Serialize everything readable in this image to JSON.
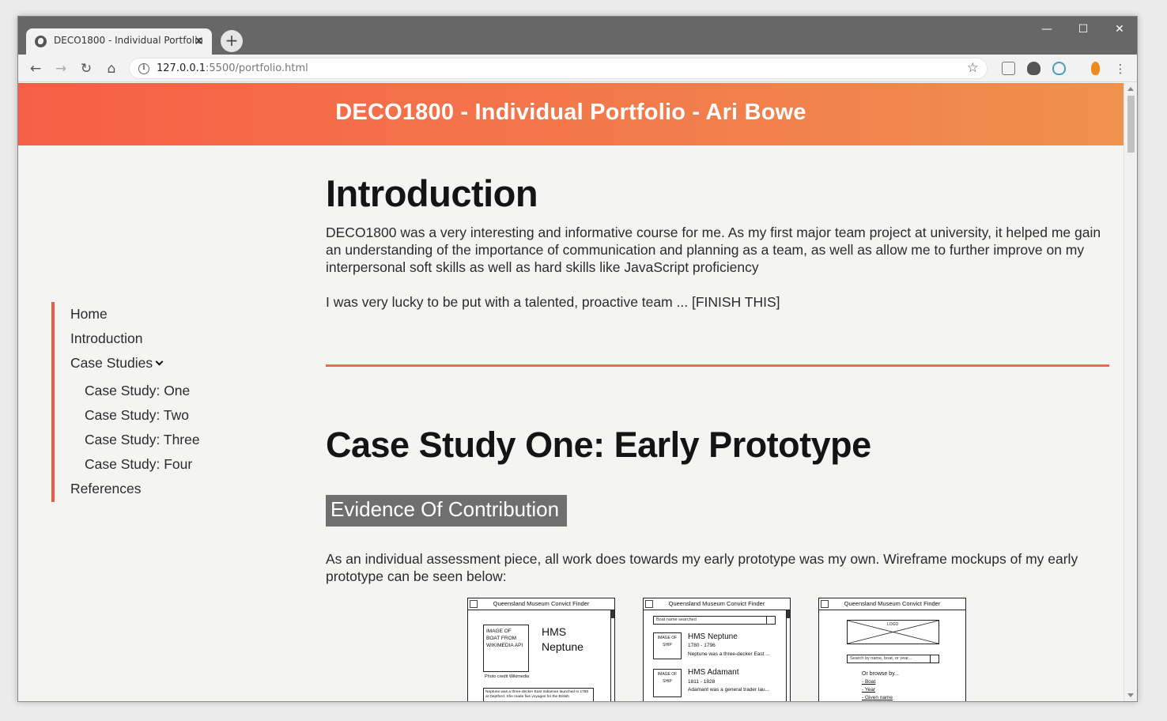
{
  "browser": {
    "tab_title": "DECO1800 - Individual Portfolio",
    "tab_close": "✕",
    "new_tab": "+",
    "url_host": "127.0.0.1",
    "url_rest": ":5500/portfolio.html",
    "window_controls": {
      "minimize": "—",
      "maximize": "☐",
      "close": "✕"
    }
  },
  "header": {
    "title": "DECO1800 - Individual Portfolio - Ari Bowe"
  },
  "sidebar": {
    "items": [
      {
        "label": "Home"
      },
      {
        "label": "Introduction"
      },
      {
        "label": "Case Studies"
      },
      {
        "label": "Case Study: One"
      },
      {
        "label": "Case Study: Two"
      },
      {
        "label": "Case Study: Three"
      },
      {
        "label": "Case Study: Four"
      },
      {
        "label": "References"
      }
    ]
  },
  "intro": {
    "heading": "Introduction",
    "paragraph1": "DECO1800 was a very interesting and informative course for me. As my first major team project at university, it helped me gain an understanding of the importance of communication and planning as a team, as well as allow me to further improve on my interpersonal soft skills as well as hard skills like JavaScript proficiency",
    "paragraph2": "I was very lucky to be put with a talented, proactive team ... [FINISH THIS]"
  },
  "case_study_one": {
    "heading": "Case Study One: Early Prototype",
    "badge": "Evidence Of Contribution",
    "paragraph": "As an individual assessment piece, all work does towards my early prototype was my own. Wireframe mockups of my early prototype can be seen below:"
  },
  "wireframes": [
    {
      "title": "Queensland Museum Convict Finder",
      "image_label": "IMAGE OF BOAT FROM WIKIMEDIA API",
      "name": "HMS Neptune",
      "credit": "Photo credit Wikimedia",
      "description": "Neptune was a three-decker East Indiaman launched in 1780 at Deptford. She made five voyages for the British"
    },
    {
      "title": "Queensland Museum Convict Finder",
      "search_text": "Boat name searched",
      "results": [
        {
          "image": "IMAGE OF SHIP",
          "name": "HMS Neptune",
          "years": "1780 - 1796",
          "desc": "Neptune was a three-decker East ..."
        },
        {
          "image": "IMAGE OF SHIP",
          "name": "HMS Adamant",
          "years": "1811 - 1828",
          "desc": "Adamant was a general trader lau..."
        }
      ]
    },
    {
      "title": "Queensland Museum Convict Finder",
      "logo": "LOGO",
      "search_placeholder": "Search by name, boat, or year...",
      "browse_label": "Or browse by...",
      "browse_items": [
        "- Boat",
        "- Year",
        "- Given name"
      ]
    }
  ]
}
